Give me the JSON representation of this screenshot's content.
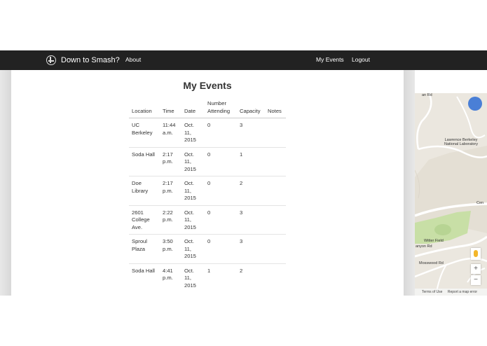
{
  "navbar": {
    "brand": "Down to Smash?",
    "about": "About",
    "my_events": "My Events",
    "logout": "Logout"
  },
  "page": {
    "title": "My Events"
  },
  "table": {
    "headers": [
      "Location",
      "Time",
      "Date",
      "Number Attending",
      "Capacity",
      "Notes"
    ],
    "rows": [
      {
        "location": "UC Berkeley",
        "time": "11:44 a.m.",
        "date": "Oct. 11, 2015",
        "attending": "0",
        "capacity": "3",
        "notes": ""
      },
      {
        "location": "Soda Hall",
        "time": "2:17 p.m.",
        "date": "Oct. 11, 2015",
        "attending": "0",
        "capacity": "1",
        "notes": ""
      },
      {
        "location": "Doe Library",
        "time": "2:17 p.m.",
        "date": "Oct. 11, 2015",
        "attending": "0",
        "capacity": "2",
        "notes": ""
      },
      {
        "location": "2601 College Ave.",
        "time": "2:22 p.m.",
        "date": "Oct. 11, 2015",
        "attending": "0",
        "capacity": "3",
        "notes": ""
      },
      {
        "location": "Sproul Plaza",
        "time": "3:50 p.m.",
        "date": "Oct. 11, 2015",
        "attending": "0",
        "capacity": "3",
        "notes": ""
      },
      {
        "location": "Soda Hall",
        "time": "4:41 p.m.",
        "date": "Oct. 11, 2015",
        "attending": "1",
        "capacity": "2",
        "notes": ""
      }
    ]
  },
  "map": {
    "labels": {
      "lab": "Lawrence Berkeley National Laboratory",
      "field": "Witter Field",
      "canyon": "anyon Rd",
      "mosswood": "Mosswood Rd",
      "road_top": "an Rd",
      "cen": "Cen"
    },
    "zoom_in": "+",
    "zoom_out": "−",
    "terms": "Terms of Use",
    "report": "Report a map error"
  },
  "colors": {
    "navbar_bg": "#222222",
    "map_bg": "#ebe7df",
    "map_green": "#c8dfa6",
    "avatar": "#4a7fd6"
  }
}
